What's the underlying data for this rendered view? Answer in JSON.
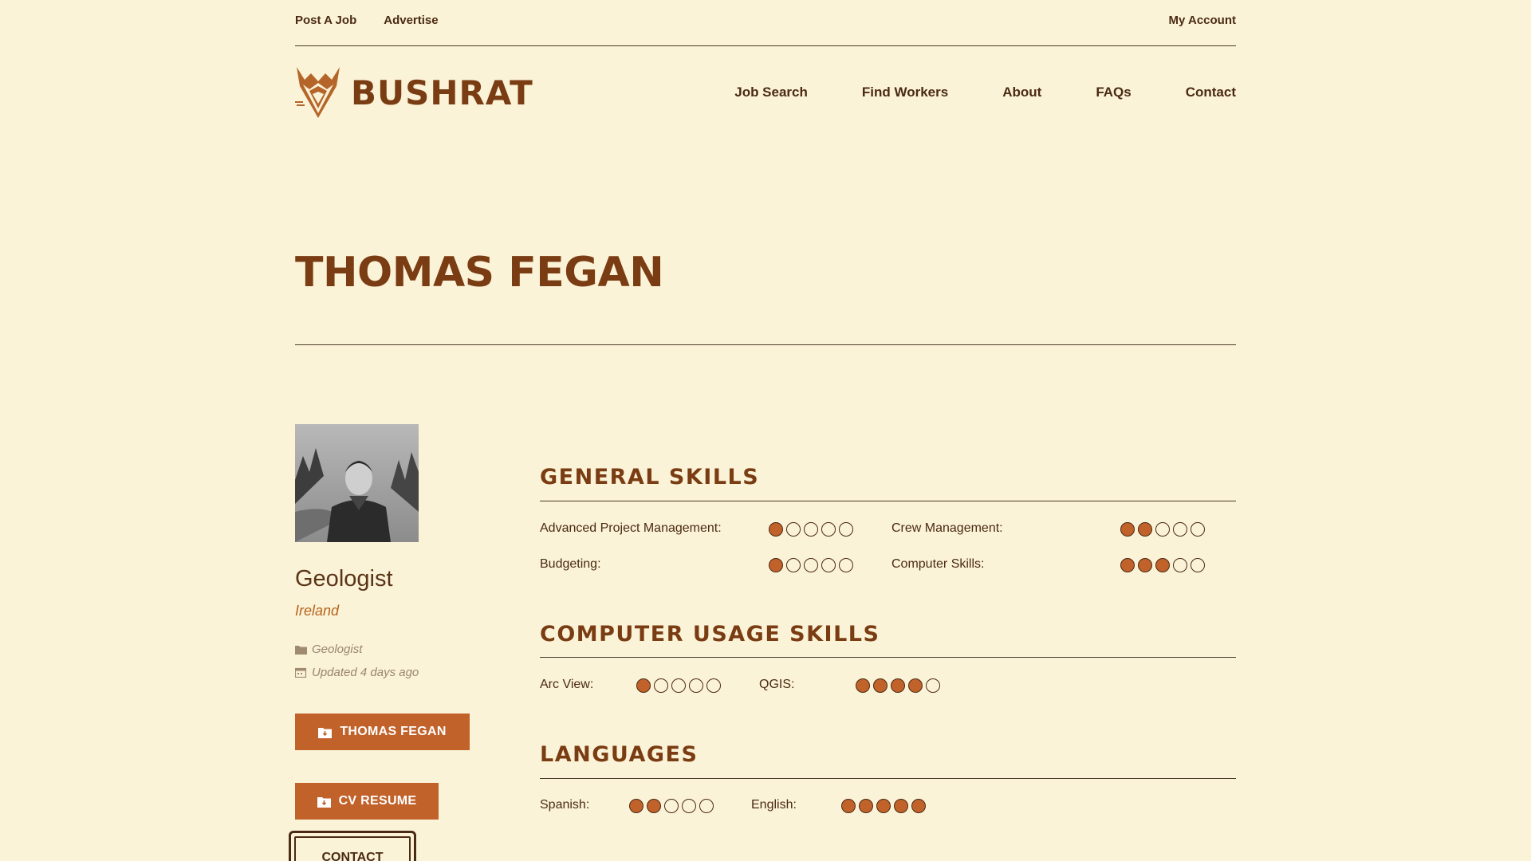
{
  "utility_nav": {
    "post_job": "Post A Job",
    "advertise": "Advertise",
    "account": "My Account"
  },
  "brand": {
    "name": "BUSHRAT",
    "logo_icon": "fox-head-icon",
    "color": "#7a3c12"
  },
  "main_nav": [
    {
      "label": "Job Search"
    },
    {
      "label": "Find Workers"
    },
    {
      "label": "About"
    },
    {
      "label": "FAQs"
    },
    {
      "label": "Contact"
    }
  ],
  "profile": {
    "name": "THOMAS FEGAN",
    "profession": "Geologist",
    "location": "Ireland",
    "category": "Geologist",
    "updated": "Updated 4 days ago",
    "photo_icon": "profile-photo"
  },
  "buttons": {
    "profile_btn": "THOMAS FEGAN",
    "cv_btn": "CV RESUME",
    "contact_btn": "CONTACT"
  },
  "sections": {
    "general": {
      "title": "GENERAL SKILLS",
      "skills": [
        {
          "label": "Advanced Project Management:",
          "rating": 1
        },
        {
          "label": "Crew Management:",
          "rating": 2
        },
        {
          "label": "Budgeting:",
          "rating": 1
        },
        {
          "label": "Computer Skills:",
          "rating": 3
        }
      ]
    },
    "computer": {
      "title": "COMPUTER USAGE SKILLS",
      "skills": [
        {
          "label": "Arc View:",
          "rating": 1
        },
        {
          "label": "QGIS:",
          "rating": 4
        }
      ]
    },
    "languages": {
      "title": "LANGUAGES",
      "skills": [
        {
          "label": "Spanish:",
          "rating": 2
        },
        {
          "label": "English:",
          "rating": 5
        }
      ]
    }
  },
  "rating_max": 5,
  "colors": {
    "accent": "#c1622b",
    "background": "#fbf3d8",
    "text": "#4a2a12"
  }
}
